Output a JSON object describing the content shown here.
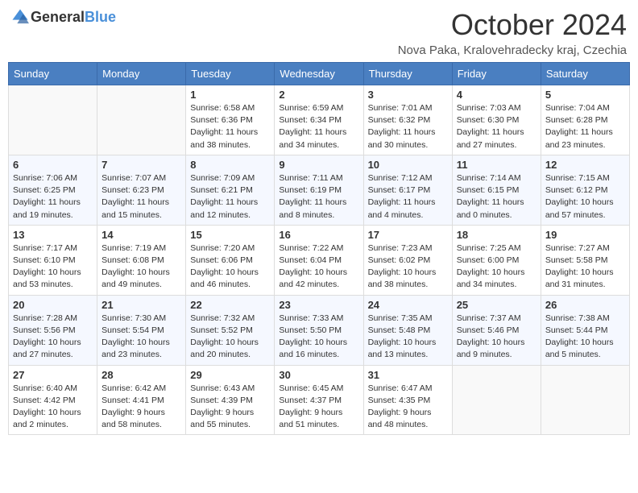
{
  "header": {
    "logo_general": "General",
    "logo_blue": "Blue",
    "month_title": "October 2024",
    "location": "Nova Paka, Kralovehradecky kraj, Czechia"
  },
  "weekdays": [
    "Sunday",
    "Monday",
    "Tuesday",
    "Wednesday",
    "Thursday",
    "Friday",
    "Saturday"
  ],
  "weeks": [
    [
      {
        "day": "",
        "sunrise": "",
        "sunset": "",
        "daylight": ""
      },
      {
        "day": "",
        "sunrise": "",
        "sunset": "",
        "daylight": ""
      },
      {
        "day": "1",
        "sunrise": "Sunrise: 6:58 AM",
        "sunset": "Sunset: 6:36 PM",
        "daylight": "Daylight: 11 hours and 38 minutes."
      },
      {
        "day": "2",
        "sunrise": "Sunrise: 6:59 AM",
        "sunset": "Sunset: 6:34 PM",
        "daylight": "Daylight: 11 hours and 34 minutes."
      },
      {
        "day": "3",
        "sunrise": "Sunrise: 7:01 AM",
        "sunset": "Sunset: 6:32 PM",
        "daylight": "Daylight: 11 hours and 30 minutes."
      },
      {
        "day": "4",
        "sunrise": "Sunrise: 7:03 AM",
        "sunset": "Sunset: 6:30 PM",
        "daylight": "Daylight: 11 hours and 27 minutes."
      },
      {
        "day": "5",
        "sunrise": "Sunrise: 7:04 AM",
        "sunset": "Sunset: 6:28 PM",
        "daylight": "Daylight: 11 hours and 23 minutes."
      }
    ],
    [
      {
        "day": "6",
        "sunrise": "Sunrise: 7:06 AM",
        "sunset": "Sunset: 6:25 PM",
        "daylight": "Daylight: 11 hours and 19 minutes."
      },
      {
        "day": "7",
        "sunrise": "Sunrise: 7:07 AM",
        "sunset": "Sunset: 6:23 PM",
        "daylight": "Daylight: 11 hours and 15 minutes."
      },
      {
        "day": "8",
        "sunrise": "Sunrise: 7:09 AM",
        "sunset": "Sunset: 6:21 PM",
        "daylight": "Daylight: 11 hours and 12 minutes."
      },
      {
        "day": "9",
        "sunrise": "Sunrise: 7:11 AM",
        "sunset": "Sunset: 6:19 PM",
        "daylight": "Daylight: 11 hours and 8 minutes."
      },
      {
        "day": "10",
        "sunrise": "Sunrise: 7:12 AM",
        "sunset": "Sunset: 6:17 PM",
        "daylight": "Daylight: 11 hours and 4 minutes."
      },
      {
        "day": "11",
        "sunrise": "Sunrise: 7:14 AM",
        "sunset": "Sunset: 6:15 PM",
        "daylight": "Daylight: 11 hours and 0 minutes."
      },
      {
        "day": "12",
        "sunrise": "Sunrise: 7:15 AM",
        "sunset": "Sunset: 6:12 PM",
        "daylight": "Daylight: 10 hours and 57 minutes."
      }
    ],
    [
      {
        "day": "13",
        "sunrise": "Sunrise: 7:17 AM",
        "sunset": "Sunset: 6:10 PM",
        "daylight": "Daylight: 10 hours and 53 minutes."
      },
      {
        "day": "14",
        "sunrise": "Sunrise: 7:19 AM",
        "sunset": "Sunset: 6:08 PM",
        "daylight": "Daylight: 10 hours and 49 minutes."
      },
      {
        "day": "15",
        "sunrise": "Sunrise: 7:20 AM",
        "sunset": "Sunset: 6:06 PM",
        "daylight": "Daylight: 10 hours and 46 minutes."
      },
      {
        "day": "16",
        "sunrise": "Sunrise: 7:22 AM",
        "sunset": "Sunset: 6:04 PM",
        "daylight": "Daylight: 10 hours and 42 minutes."
      },
      {
        "day": "17",
        "sunrise": "Sunrise: 7:23 AM",
        "sunset": "Sunset: 6:02 PM",
        "daylight": "Daylight: 10 hours and 38 minutes."
      },
      {
        "day": "18",
        "sunrise": "Sunrise: 7:25 AM",
        "sunset": "Sunset: 6:00 PM",
        "daylight": "Daylight: 10 hours and 34 minutes."
      },
      {
        "day": "19",
        "sunrise": "Sunrise: 7:27 AM",
        "sunset": "Sunset: 5:58 PM",
        "daylight": "Daylight: 10 hours and 31 minutes."
      }
    ],
    [
      {
        "day": "20",
        "sunrise": "Sunrise: 7:28 AM",
        "sunset": "Sunset: 5:56 PM",
        "daylight": "Daylight: 10 hours and 27 minutes."
      },
      {
        "day": "21",
        "sunrise": "Sunrise: 7:30 AM",
        "sunset": "Sunset: 5:54 PM",
        "daylight": "Daylight: 10 hours and 23 minutes."
      },
      {
        "day": "22",
        "sunrise": "Sunrise: 7:32 AM",
        "sunset": "Sunset: 5:52 PM",
        "daylight": "Daylight: 10 hours and 20 minutes."
      },
      {
        "day": "23",
        "sunrise": "Sunrise: 7:33 AM",
        "sunset": "Sunset: 5:50 PM",
        "daylight": "Daylight: 10 hours and 16 minutes."
      },
      {
        "day": "24",
        "sunrise": "Sunrise: 7:35 AM",
        "sunset": "Sunset: 5:48 PM",
        "daylight": "Daylight: 10 hours and 13 minutes."
      },
      {
        "day": "25",
        "sunrise": "Sunrise: 7:37 AM",
        "sunset": "Sunset: 5:46 PM",
        "daylight": "Daylight: 10 hours and 9 minutes."
      },
      {
        "day": "26",
        "sunrise": "Sunrise: 7:38 AM",
        "sunset": "Sunset: 5:44 PM",
        "daylight": "Daylight: 10 hours and 5 minutes."
      }
    ],
    [
      {
        "day": "27",
        "sunrise": "Sunrise: 6:40 AM",
        "sunset": "Sunset: 4:42 PM",
        "daylight": "Daylight: 10 hours and 2 minutes."
      },
      {
        "day": "28",
        "sunrise": "Sunrise: 6:42 AM",
        "sunset": "Sunset: 4:41 PM",
        "daylight": "Daylight: 9 hours and 58 minutes."
      },
      {
        "day": "29",
        "sunrise": "Sunrise: 6:43 AM",
        "sunset": "Sunset: 4:39 PM",
        "daylight": "Daylight: 9 hours and 55 minutes."
      },
      {
        "day": "30",
        "sunrise": "Sunrise: 6:45 AM",
        "sunset": "Sunset: 4:37 PM",
        "daylight": "Daylight: 9 hours and 51 minutes."
      },
      {
        "day": "31",
        "sunrise": "Sunrise: 6:47 AM",
        "sunset": "Sunset: 4:35 PM",
        "daylight": "Daylight: 9 hours and 48 minutes."
      },
      {
        "day": "",
        "sunrise": "",
        "sunset": "",
        "daylight": ""
      },
      {
        "day": "",
        "sunrise": "",
        "sunset": "",
        "daylight": ""
      }
    ]
  ]
}
